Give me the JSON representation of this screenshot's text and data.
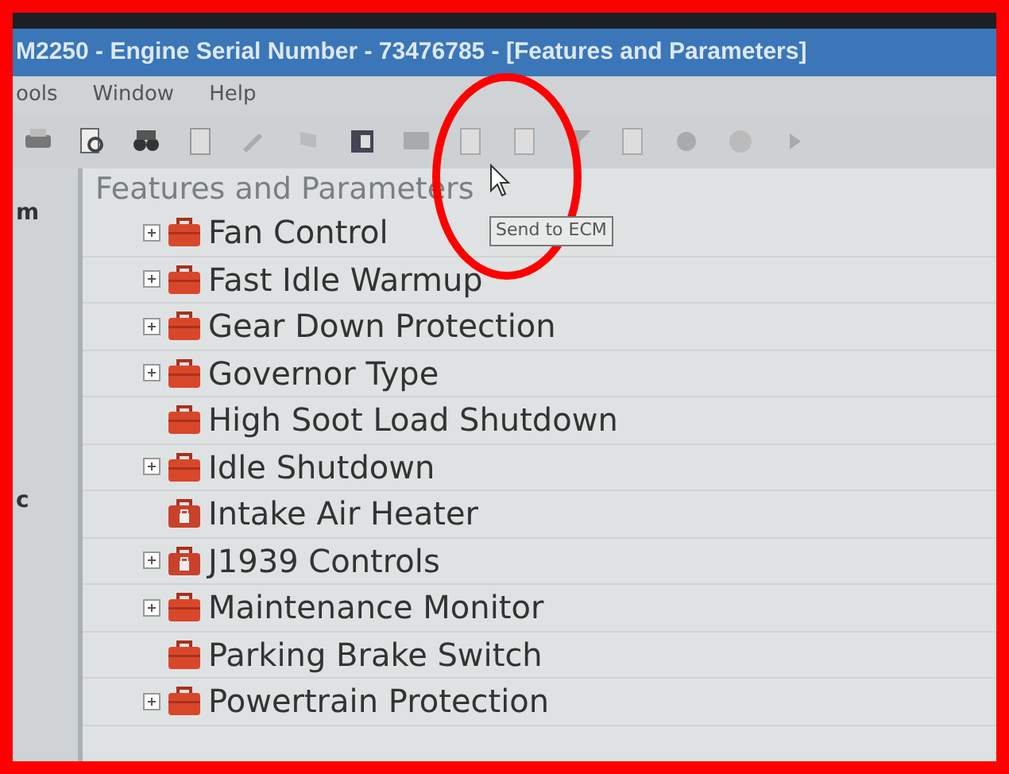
{
  "window": {
    "title": "M2250 - Engine Serial Number - 73476785 - [Features and Parameters]"
  },
  "menu": [
    "ools",
    "Window",
    "Help"
  ],
  "tooltip": "Send to ECM",
  "sidebar": {
    "items": [
      "m",
      "c"
    ]
  },
  "panel": {
    "title": "Features and Parameters"
  },
  "tree": [
    {
      "label": "Fan Control",
      "expandable": true,
      "kind": "folder"
    },
    {
      "label": "Fast Idle Warmup",
      "expandable": true,
      "kind": "folder"
    },
    {
      "label": "Gear Down Protection",
      "expandable": true,
      "kind": "folder"
    },
    {
      "label": "Governor Type",
      "expandable": true,
      "kind": "folder"
    },
    {
      "label": "High Soot Load Shutdown",
      "expandable": false,
      "kind": "folder"
    },
    {
      "label": "Idle Shutdown",
      "expandable": true,
      "kind": "folder"
    },
    {
      "label": "Intake Air Heater",
      "expandable": false,
      "kind": "locked"
    },
    {
      "label": "J1939 Controls",
      "expandable": true,
      "kind": "locked"
    },
    {
      "label": "Maintenance Monitor",
      "expandable": true,
      "kind": "folder"
    },
    {
      "label": "Parking Brake Switch",
      "expandable": false,
      "kind": "folder"
    },
    {
      "label": "Powertrain Protection",
      "expandable": true,
      "kind": "folder"
    }
  ]
}
